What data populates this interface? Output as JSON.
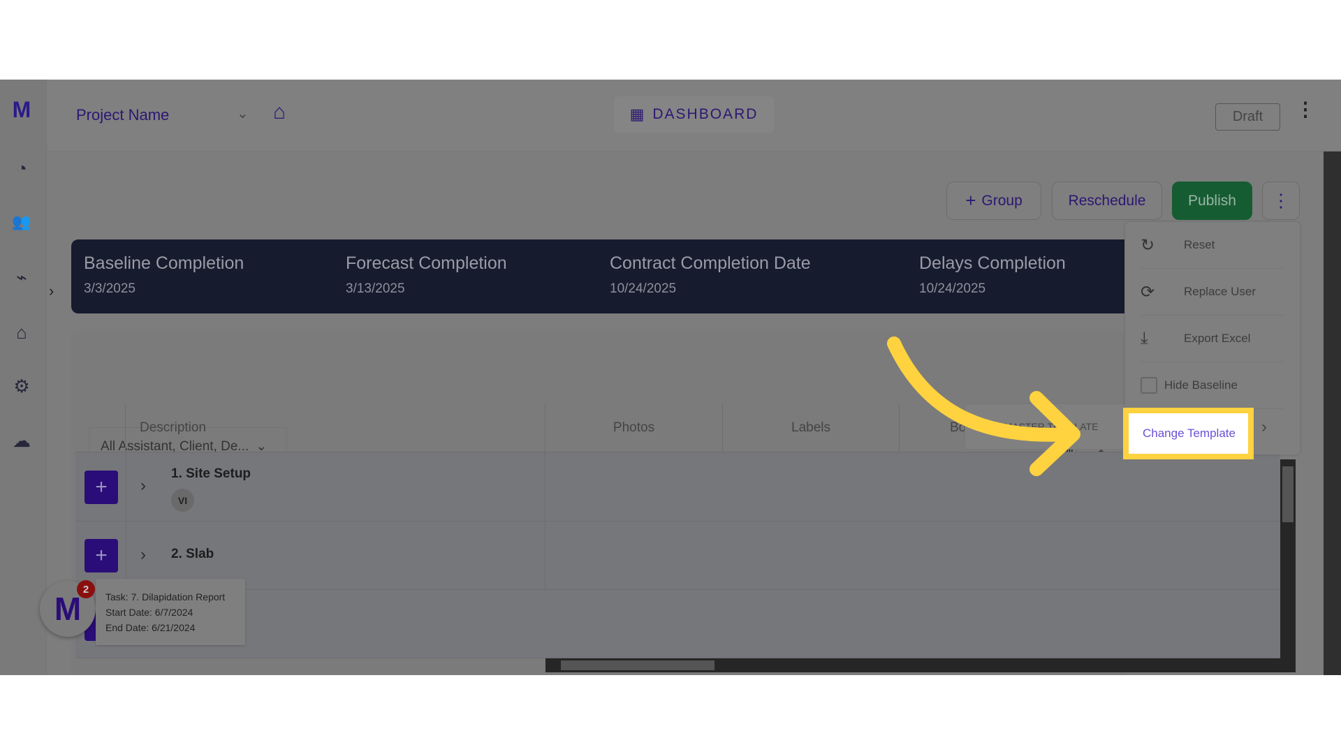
{
  "header": {
    "project_name": "Project Name",
    "dashboard_label": "DASHBOARD",
    "status": "Draft"
  },
  "sidebar": {
    "items": [
      {
        "icon": "gauge-icon"
      },
      {
        "icon": "users-icon"
      },
      {
        "icon": "chart-icon"
      },
      {
        "icon": "presentation-icon"
      },
      {
        "icon": "gear-icon"
      },
      {
        "icon": "cloud-network-icon"
      }
    ]
  },
  "toolbar": {
    "group_label": "Group",
    "reschedule_label": "Reschedule",
    "publish_label": "Publish"
  },
  "banner": [
    {
      "title": "Baseline Completion",
      "date": "3/3/2025"
    },
    {
      "title": "Forecast Completion",
      "date": "3/13/2025"
    },
    {
      "title": "Contract Completion Date",
      "date": "10/24/2025"
    },
    {
      "title": "Delays Completion",
      "date": "10/24/2025"
    }
  ],
  "menu": {
    "items": [
      "Reset",
      "Replace User",
      "Export Excel",
      "Hide Baseline",
      "Change Template"
    ]
  },
  "filter": {
    "value": "All Assistant, Client, De..."
  },
  "table": {
    "columns": [
      "Description",
      "Photos",
      "Labels",
      "Bo"
    ],
    "tooltip": "MASTER TEMPLATE",
    "rows": [
      {
        "name": "1. Site Setup",
        "avatar": "VI"
      },
      {
        "name": "2. Slab"
      }
    ]
  },
  "notification": {
    "count": "2",
    "task": "Task: 7. Dilapidation Report",
    "start": "Start Date: 6/7/2024",
    "end": "End Date: 6/21/2024"
  },
  "colors": {
    "highlight": "#ffd23f",
    "accent": "#2a0d78",
    "publish": "#165c33"
  }
}
